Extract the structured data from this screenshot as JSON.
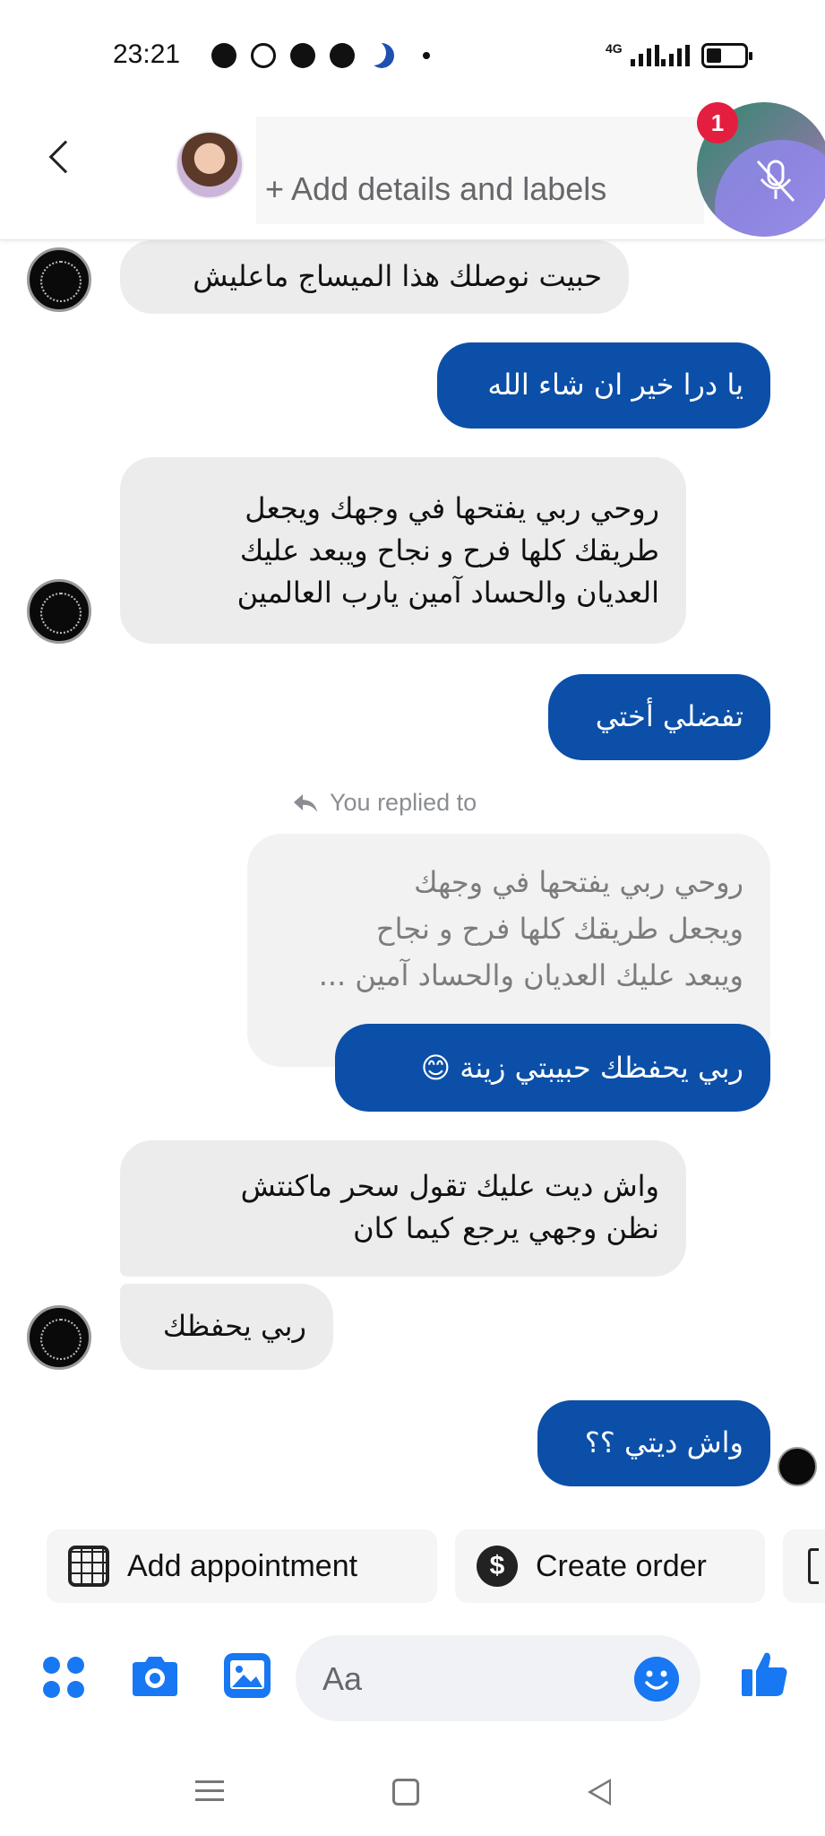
{
  "status_bar": {
    "time": "23:21",
    "network": "4G",
    "icons": [
      "media-icon",
      "sync-icon",
      "messenger-icon",
      "facebook-icon",
      "moon-icon",
      "dot-icon",
      "signal-icon",
      "wifi-bars-icon",
      "battery-icon"
    ]
  },
  "header": {
    "subtitle": "+ Add details and labels",
    "back_icon": "chevron-left-icon"
  },
  "call_bubble": {
    "badge_count": "1",
    "icon": "mic-off-icon"
  },
  "messages": [
    {
      "direction": "incoming",
      "text": "حبيت نوصلك هذا الميساج ماعليش"
    },
    {
      "direction": "outgoing",
      "text": "يا درا خير ان شاء الله"
    },
    {
      "direction": "incoming",
      "text": "روحي ربي يفتحها في وجهك ويجعل\nطريقك كلها فرح و نجاح ويبعد عليك\nالعديان والحساد آمين يارب العالمين"
    },
    {
      "direction": "outgoing",
      "text": "تفضلي أختي"
    },
    {
      "direction": "outgoing",
      "text": "ربي يحفظك حبيبتي زينة 😊"
    },
    {
      "direction": "incoming",
      "text": "واش ديت عليك تقول سحر ماكنتش\nنظن وجهي يرجع كيما كان"
    },
    {
      "direction": "incoming",
      "text": "ربي يحفظك"
    },
    {
      "direction": "outgoing",
      "text": "واش ديتي ؟؟"
    }
  ],
  "reply": {
    "label": "You replied to",
    "quoted_text": "روحي ربي يفتحها في وجهك\nويجعل طريقك كلها فرح و نجاح\nويبعد عليك العديان والحساد آمين ..."
  },
  "quick_actions": [
    {
      "label": "Add appointment",
      "icon": "calendar-icon"
    },
    {
      "label": "Create order",
      "icon": "dollar-icon"
    }
  ],
  "composer": {
    "placeholder": "Aa",
    "icons": [
      "apps-grid-icon",
      "camera-icon",
      "image-icon",
      "emoji-icon",
      "like-icon"
    ]
  },
  "colors": {
    "outgoing_bubble": "#0b4fa8",
    "incoming_bubble": "#ececec",
    "accent": "#1877f2",
    "badge": "#e41e3f"
  }
}
